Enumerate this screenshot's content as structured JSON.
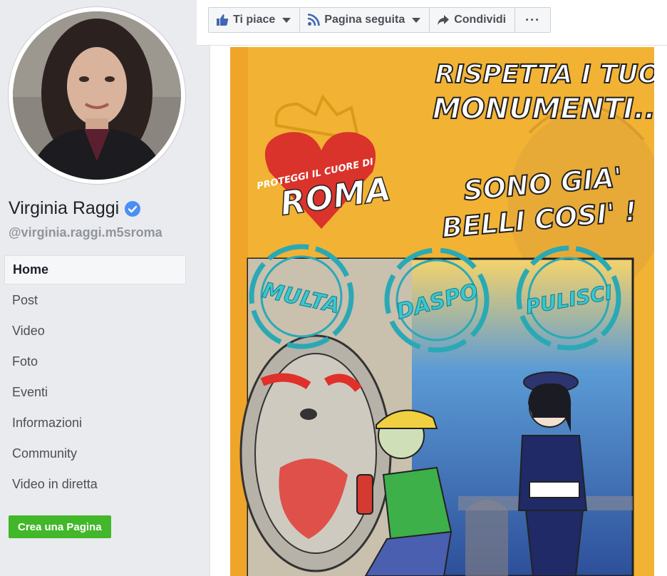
{
  "page": {
    "name": "Virginia Raggi",
    "username": "@virginia.raggi.m5sroma"
  },
  "nav": {
    "items": [
      {
        "label": "Home"
      },
      {
        "label": "Post"
      },
      {
        "label": "Video"
      },
      {
        "label": "Foto"
      },
      {
        "label": "Eventi"
      },
      {
        "label": "Informazioni"
      },
      {
        "label": "Community"
      },
      {
        "label": "Video in diretta"
      }
    ],
    "active_index": 0
  },
  "create_page_label": "Crea una Pagina",
  "actions": {
    "like_label": "Ti piace",
    "follow_label": "Pagina seguita",
    "share_label": "Condividi",
    "more_label": "···"
  },
  "poster": {
    "headline_line1": "RISPETTA I TUOI",
    "headline_line2": "MONUMENTI...",
    "headline_line3": "SONO GIA'",
    "headline_line4": "BELLI COSI' !",
    "heart_top": "PROTEGGI IL CUORE DI",
    "heart_main": "ROMA",
    "stamp1": "MULTA",
    "stamp2": "DASPO",
    "stamp3": "PULISCI"
  },
  "colors": {
    "brand_blue": "#4267b2",
    "verified_blue": "#4a8ff4",
    "create_green": "#42b72a",
    "poster_orange": "#f2b233",
    "stamp_teal": "#2aa9b5",
    "heart_red": "#d9332b"
  },
  "icons": {
    "like": "thumbs-up-icon",
    "follow": "rss-icon",
    "share": "share-arrow-icon",
    "verified": "verified-badge-icon"
  }
}
